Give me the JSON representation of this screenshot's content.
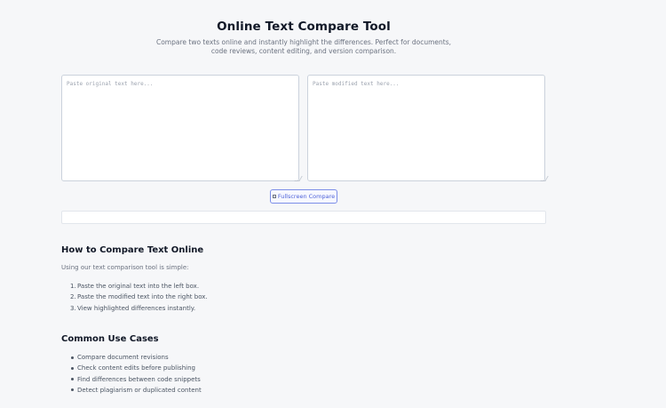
{
  "header": {
    "title": "Online Text Compare Tool",
    "subtitle": "Compare two texts online and instantly highlight the differences. Perfect for documents, code reviews, content editing, and version comparison."
  },
  "editors": {
    "original": {
      "placeholder": "Paste original text here...",
      "value": ""
    },
    "modified": {
      "placeholder": "Paste modified text here...",
      "value": ""
    }
  },
  "actions": {
    "fullscreen_icon": "expand-icon",
    "fullscreen_label": "Fullscreen Compare"
  },
  "how_to": {
    "heading": "How to Compare Text Online",
    "intro": "Using our text comparison tool is simple:",
    "steps": [
      {
        "num": "1.",
        "text": "Paste the original text into the left box."
      },
      {
        "num": "2.",
        "text": "Paste the modified text into the right box."
      },
      {
        "num": "3.",
        "text": "View highlighted differences instantly."
      }
    ]
  },
  "use_cases": {
    "heading": "Common Use Cases",
    "items": [
      "Compare document revisions",
      "Check content edits before publishing",
      "Find differences between code snippets",
      "Detect plagiarism or duplicated content"
    ]
  },
  "colors": {
    "accent": "#4f63d9",
    "background": "#f6f7f9"
  }
}
